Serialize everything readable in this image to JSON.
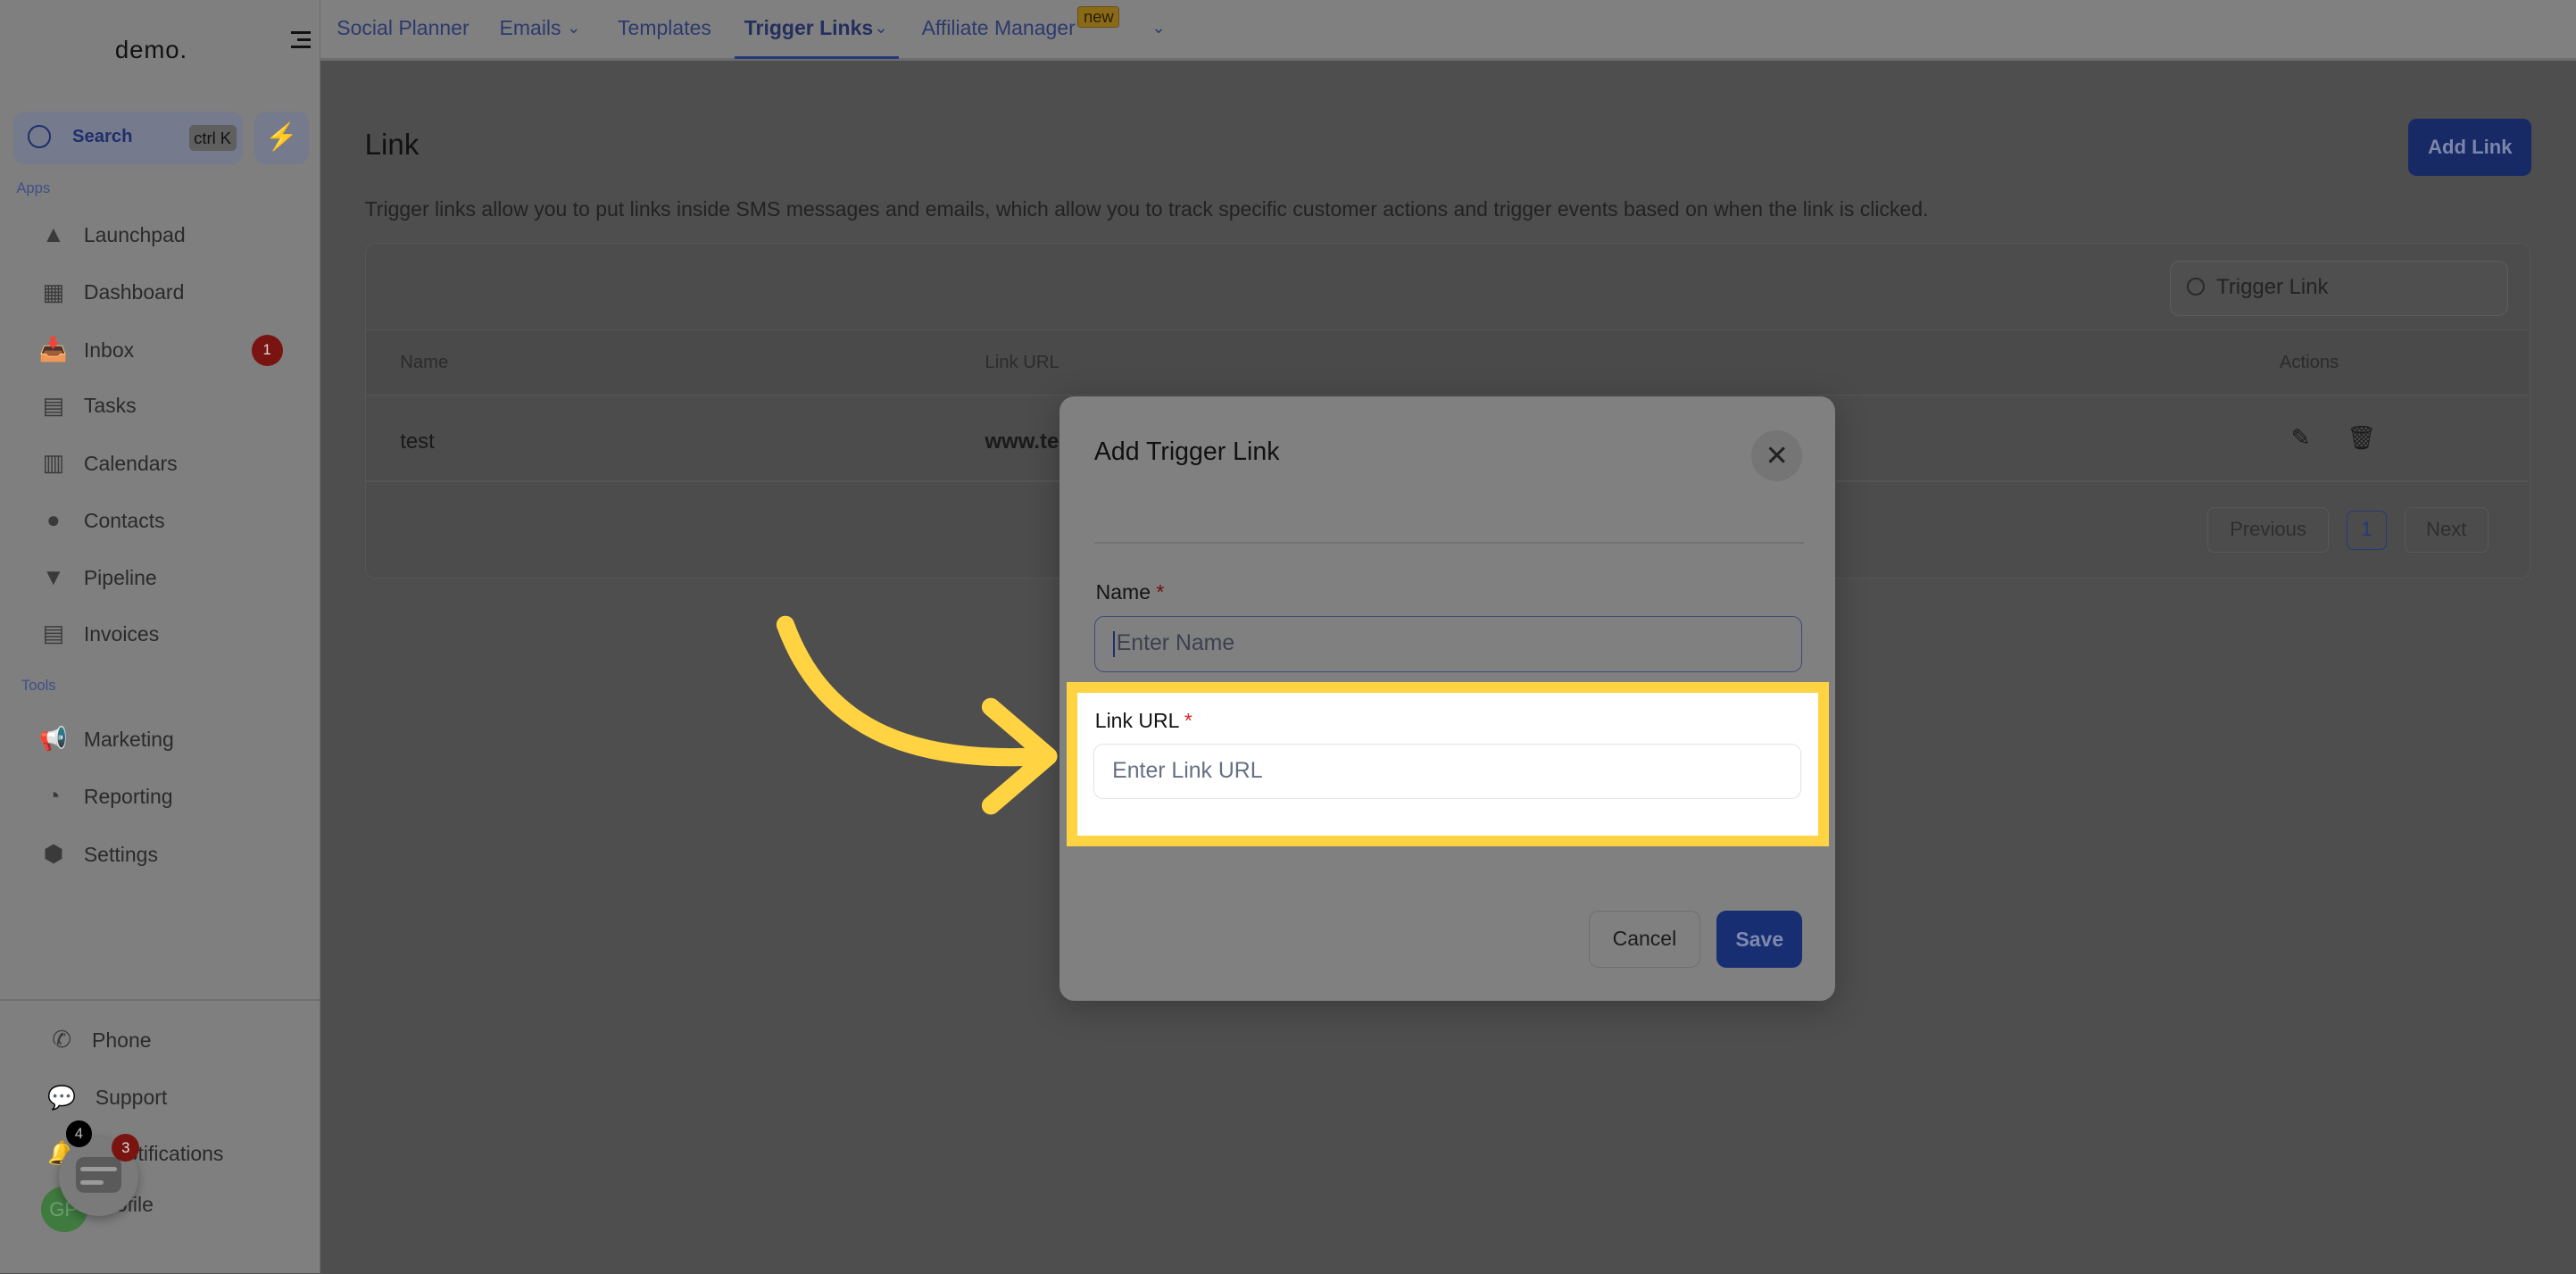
{
  "sidebar": {
    "logo": "demo.",
    "search": {
      "label": "Search",
      "shortcut": "ctrl K"
    },
    "apps_label": "Apps",
    "tools_label": "Tools",
    "apps": [
      {
        "label": "Launchpad",
        "icon": "rocket-icon"
      },
      {
        "label": "Dashboard",
        "icon": "grid-icon"
      },
      {
        "label": "Inbox",
        "icon": "inbox-icon",
        "badge": "1"
      },
      {
        "label": "Tasks",
        "icon": "clipboard-icon"
      },
      {
        "label": "Calendars",
        "icon": "calendar-icon"
      },
      {
        "label": "Contacts",
        "icon": "user-icon"
      },
      {
        "label": "Pipeline",
        "icon": "funnel-icon"
      },
      {
        "label": "Invoices",
        "icon": "receipt-icon"
      }
    ],
    "tools": [
      {
        "label": "Marketing",
        "icon": "megaphone-icon"
      },
      {
        "label": "Reporting",
        "icon": "pie-chart-icon"
      },
      {
        "label": "Settings",
        "icon": "gear-icon"
      }
    ],
    "bottom": [
      {
        "label": "Phone",
        "icon": "phone-icon"
      },
      {
        "label": "Support",
        "icon": "chat-icon"
      },
      {
        "label": "Notifications",
        "icon": "bell-icon"
      },
      {
        "label": "Profile",
        "icon": "avatar-icon"
      }
    ],
    "avatar_initials": "GP",
    "chat_widget": {
      "badge_black": "4",
      "badge_red": "3"
    }
  },
  "topnav": {
    "tabs": [
      "Social Planner",
      "Emails",
      "Templates",
      "Trigger Links",
      "Affiliate Manager"
    ],
    "active": "Trigger Links",
    "new_badge": "new"
  },
  "main": {
    "title": "Link",
    "add_button": "Add Link",
    "description": "Trigger links allow you to put links inside SMS messages and emails, which allow you to track specific customer actions and trigger events based on when the link is clicked.",
    "search_placeholder": "Trigger Link",
    "columns": [
      "Name",
      "Link URL",
      "Actions"
    ],
    "rows": [
      {
        "name": "test",
        "url": "www.te"
      }
    ],
    "pagination": {
      "previous": "Previous",
      "page": "1",
      "next": "Next"
    }
  },
  "modal": {
    "title": "Add Trigger Link",
    "name_label": "Name",
    "name_placeholder": "Enter Name",
    "url_label": "Link URL",
    "url_placeholder": "Enter Link URL",
    "required_mark": "*",
    "cancel": "Cancel",
    "save": "Save"
  },
  "colors": {
    "accent": "#1e3a8a",
    "highlight": "#ffd342",
    "badge": "#b91c1c"
  }
}
